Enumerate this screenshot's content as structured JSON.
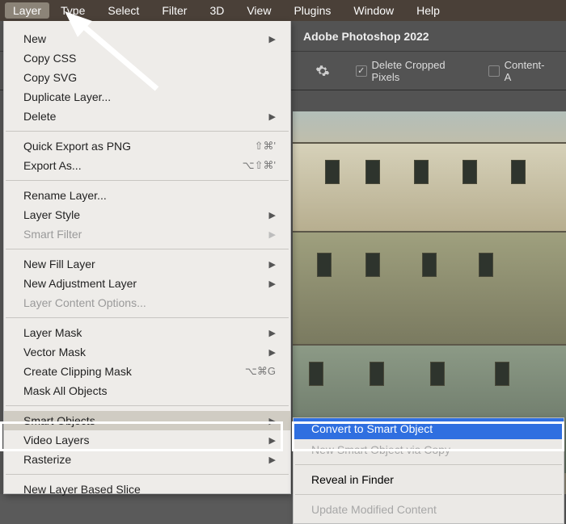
{
  "menubar": {
    "items": [
      "Layer",
      "Type",
      "Select",
      "Filter",
      "3D",
      "View",
      "Plugins",
      "Window",
      "Help"
    ],
    "openIndex": 0
  },
  "appHeader": {
    "title": "Adobe Photoshop 2022"
  },
  "toolbar": {
    "gearIconName": "gear-icon",
    "deleteCropped": {
      "label": "Delete Cropped Pixels",
      "checked": true
    },
    "contentAware": {
      "label": "Content-A",
      "checked": false
    }
  },
  "layerMenu": {
    "groups": [
      [
        {
          "label": "New",
          "sub": true
        },
        {
          "label": "Copy CSS"
        },
        {
          "label": "Copy SVG"
        },
        {
          "label": "Duplicate Layer..."
        },
        {
          "label": "Delete",
          "sub": true
        }
      ],
      [
        {
          "label": "Quick Export as PNG",
          "shortcut": "⇧⌘'"
        },
        {
          "label": "Export As...",
          "shortcut": "⌥⇧⌘'"
        }
      ],
      [
        {
          "label": "Rename Layer..."
        },
        {
          "label": "Layer Style",
          "sub": true
        },
        {
          "label": "Smart Filter",
          "sub": true,
          "disabled": true
        }
      ],
      [
        {
          "label": "New Fill Layer",
          "sub": true
        },
        {
          "label": "New Adjustment Layer",
          "sub": true
        },
        {
          "label": "Layer Content Options...",
          "disabled": true
        }
      ],
      [
        {
          "label": "Layer Mask",
          "sub": true
        },
        {
          "label": "Vector Mask",
          "sub": true
        },
        {
          "label": "Create Clipping Mask",
          "shortcut": "⌥⌘G"
        },
        {
          "label": "Mask All Objects"
        }
      ],
      [
        {
          "label": "Smart Objects",
          "sub": true,
          "highlight": true
        },
        {
          "label": "Video Layers",
          "sub": true
        },
        {
          "label": "Rasterize",
          "sub": true
        }
      ],
      [
        {
          "label": "New Layer Based Slice"
        }
      ]
    ]
  },
  "smartObjectsSubmenu": {
    "items": [
      {
        "label": "Convert to Smart Object",
        "selected": true
      },
      {
        "label": "New Smart Object via Copy",
        "disabled": true
      },
      {
        "sep": true
      },
      {
        "label": "Reveal in Finder"
      },
      {
        "sep": true
      },
      {
        "label": "Update Modified Content",
        "disabled": true
      }
    ]
  }
}
